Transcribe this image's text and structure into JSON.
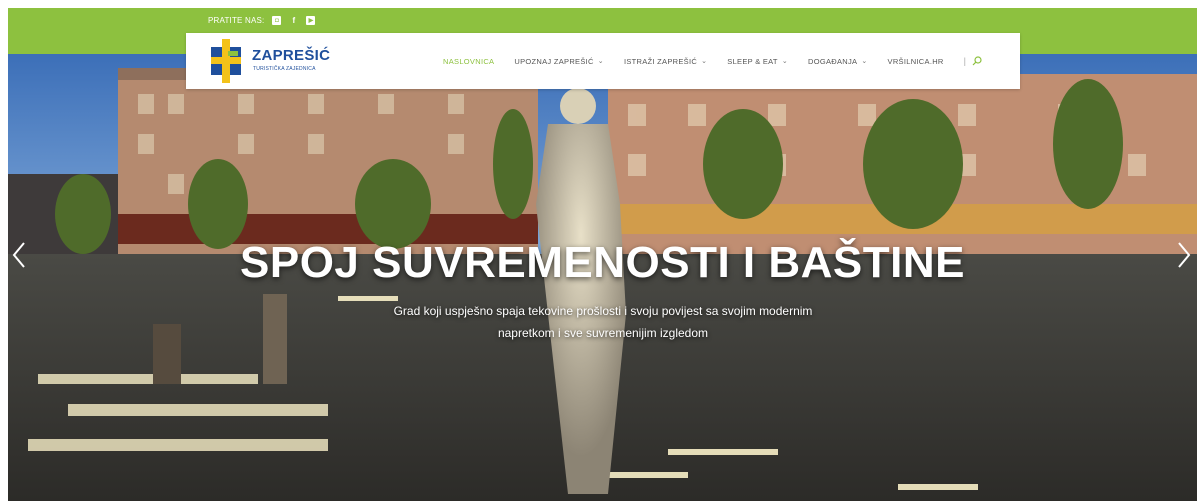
{
  "topbar": {
    "follow_label": "PRATITE NAS:",
    "social": [
      {
        "icon": "instagram-icon",
        "glyph": "◘"
      },
      {
        "icon": "facebook-icon",
        "glyph": "f"
      },
      {
        "icon": "youtube-icon",
        "glyph": "▶"
      }
    ]
  },
  "brand": {
    "name": "ZAPREŠIĆ",
    "subtitle": "TURISTIČKA ZAJEDNICA",
    "colors": {
      "green": "#8dc13f",
      "blue": "#1f4f9c",
      "yellow": "#f3c21a"
    }
  },
  "nav": {
    "items": [
      {
        "label": "NASLOVNICA",
        "active": true,
        "dropdown": false
      },
      {
        "label": "UPOZNAJ ZAPREŠIĆ",
        "active": false,
        "dropdown": true
      },
      {
        "label": "ISTRAŽI ZAPREŠIĆ",
        "active": false,
        "dropdown": true
      },
      {
        "label": "SLEEP & EAT",
        "active": false,
        "dropdown": true
      },
      {
        "label": "DOGAĐANJA",
        "active": false,
        "dropdown": true
      },
      {
        "label": "VRŠILNICA.HR",
        "active": false,
        "dropdown": false
      }
    ],
    "separator": "|",
    "search_icon": "search-icon"
  },
  "hero": {
    "headline": "SPOJ SUVREMENOSTI I BAŠTINE",
    "subline_1": "Grad koji uspješno spaja tekovine prošlosti i svoju povijest sa svojim modernim",
    "subline_2": "napretkom i sve suvremenijim izgledom",
    "prev_icon": "chevron-left-icon",
    "next_icon": "chevron-right-icon"
  }
}
